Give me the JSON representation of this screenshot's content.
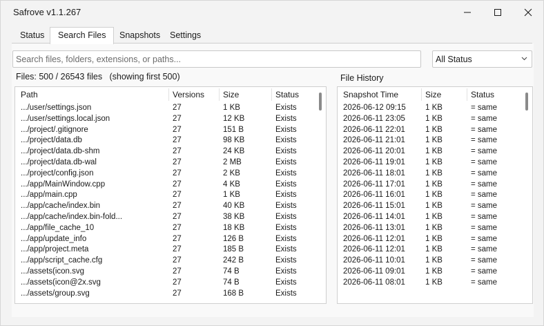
{
  "app": {
    "title": "Safrove v1.1.267"
  },
  "tabs": [
    {
      "label": "Status"
    },
    {
      "label": "Search Files"
    },
    {
      "label": "Snapshots"
    },
    {
      "label": "Settings"
    }
  ],
  "active_tab": "Search Files",
  "search": {
    "value": "",
    "placeholder": "Search files, folders, extensions, or paths..."
  },
  "status_filter": {
    "selected": "All Status"
  },
  "files_summary": "Files: 500 / 26543 files   (showing first 500)",
  "files_table": {
    "columns": [
      "Path",
      "Versions",
      "Size",
      "Status"
    ],
    "rows": [
      [
        ".../user/settings.json",
        "27",
        "1 KB",
        "Exists"
      ],
      [
        ".../user/settings.local.json",
        "27",
        "12 KB",
        "Exists"
      ],
      [
        ".../project/.gitignore",
        "27",
        "151 B",
        "Exists"
      ],
      [
        ".../project/data.db",
        "27",
        "98 KB",
        "Exists"
      ],
      [
        ".../project/data.db-shm",
        "27",
        "24 KB",
        "Exists"
      ],
      [
        ".../project/data.db-wal",
        "27",
        "2 MB",
        "Exists"
      ],
      [
        ".../project/config.json",
        "27",
        "2 KB",
        "Exists"
      ],
      [
        ".../app/MainWindow.cpp",
        "27",
        "4 KB",
        "Exists"
      ],
      [
        ".../app/main.cpp",
        "27",
        "1 KB",
        "Exists"
      ],
      [
        ".../app/cache/index.bin",
        "27",
        "40 KB",
        "Exists"
      ],
      [
        ".../app/cache/index.bin-fold...",
        "27",
        "38 KB",
        "Exists"
      ],
      [
        ".../app/file_cache_10",
        "27",
        "18 KB",
        "Exists"
      ],
      [
        ".../app/update_info",
        "27",
        "126 B",
        "Exists"
      ],
      [
        ".../app/project.meta",
        "27",
        "185 B",
        "Exists"
      ],
      [
        ".../app/script_cache.cfg",
        "27",
        "242 B",
        "Exists"
      ],
      [
        ".../assets(icon.svg",
        "27",
        "74 B",
        "Exists"
      ],
      [
        ".../assets(icon@2x.svg",
        "27",
        "74 B",
        "Exists"
      ],
      [
        ".../assets/group.svg",
        "27",
        "168 B",
        "Exists"
      ]
    ]
  },
  "history": {
    "title": "File History",
    "columns": [
      "Snapshot Time",
      "Size",
      "Status"
    ],
    "rows": [
      [
        "2026-06-12 09:15",
        "1 KB",
        "= same"
      ],
      [
        "2026-06-11 23:05",
        "1 KB",
        "= same"
      ],
      [
        "2026-06-11 22:01",
        "1 KB",
        "= same"
      ],
      [
        "2026-06-11 21:01",
        "1 KB",
        "= same"
      ],
      [
        "2026-06-11 20:01",
        "1 KB",
        "= same"
      ],
      [
        "2026-06-11 19:01",
        "1 KB",
        "= same"
      ],
      [
        "2026-06-11 18:01",
        "1 KB",
        "= same"
      ],
      [
        "2026-06-11 17:01",
        "1 KB",
        "= same"
      ],
      [
        "2026-06-11 16:01",
        "1 KB",
        "= same"
      ],
      [
        "2026-06-11 15:01",
        "1 KB",
        "= same"
      ],
      [
        "2026-06-11 14:01",
        "1 KB",
        "= same"
      ],
      [
        "2026-06-11 13:01",
        "1 KB",
        "= same"
      ],
      [
        "2026-06-11 12:01",
        "1 KB",
        "= same"
      ],
      [
        "2026-06-11 12:01",
        "1 KB",
        "= same"
      ],
      [
        "2026-06-11 10:01",
        "1 KB",
        "= same"
      ],
      [
        "2026-06-11 09:01",
        "1 KB",
        "= same"
      ],
      [
        "2026-06-11 08:01",
        "1 KB",
        "= same"
      ]
    ]
  },
  "icons": {
    "minimize": "minimize-icon",
    "maximize": "maximize-icon",
    "close": "close-icon",
    "dropdown": "chevron-down-icon"
  }
}
